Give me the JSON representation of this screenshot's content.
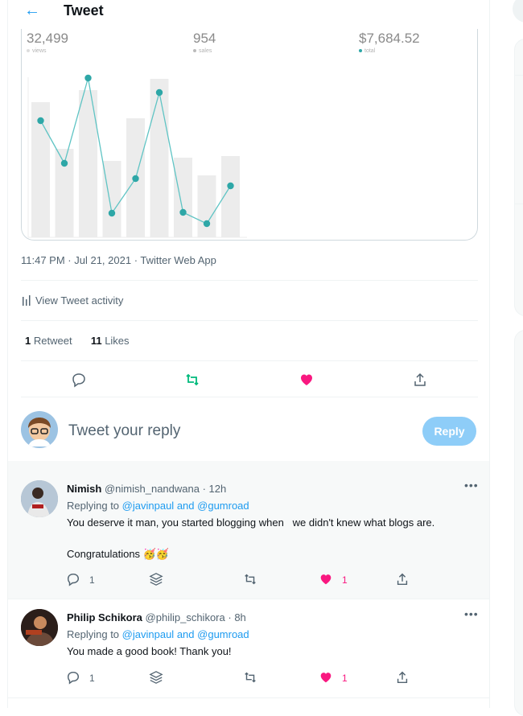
{
  "header": {
    "title": "Tweet"
  },
  "chart_card": {
    "stats": [
      {
        "value": "32,499",
        "label": "views"
      },
      {
        "value": "954",
        "label": "sales"
      },
      {
        "value": "$7,684.52",
        "label": "total"
      }
    ],
    "chart_data": {
      "type": "bar",
      "series": [
        {
          "values": [
            168,
            110,
            183,
            95,
            148,
            197,
            99,
            77,
            101
          ]
        },
        {
          "values": [
            145,
            92,
            198,
            30,
            73,
            180,
            31,
            17,
            64
          ]
        }
      ],
      "colors": {
        "bars": "#ececec",
        "line": "#5fc4c4",
        "points": "#2ea7a7"
      }
    }
  },
  "meta": {
    "time": "11:47 PM · Jul 21, 2021",
    "client": "Twitter Web App"
  },
  "activity": {
    "label": "View Tweet activity"
  },
  "counts": {
    "retweets": "1",
    "retweets_label": "Retweet",
    "likes": "11",
    "likes_label": "Likes"
  },
  "compose": {
    "placeholder": "Tweet your reply",
    "button": "Reply"
  },
  "replies": [
    {
      "name": "Nimish",
      "handle": "@nimish_nandwana",
      "time": "12h",
      "replying_to": "Replying to",
      "mention1": "@javinpaul",
      "and": "and",
      "mention2": "@gumroad",
      "text": "You deserve it man, you started blogging when   we didn't knew what blogs are.",
      "text2": "Congratulations",
      "reply_count": "1",
      "like_count": "1"
    },
    {
      "name": "Philip Schikora",
      "handle": "@philip_schikora",
      "time": "8h",
      "replying_to": "Replying to",
      "mention1": "@javinpaul",
      "and": "and",
      "mention2": "@gumroad",
      "text": "You made a good book! Thank you!",
      "reply_count": "1",
      "like_count": "1"
    }
  ],
  "colors": {
    "accent": "#1d9bf0",
    "retweet": "#00ba7c",
    "like": "#f91880"
  }
}
